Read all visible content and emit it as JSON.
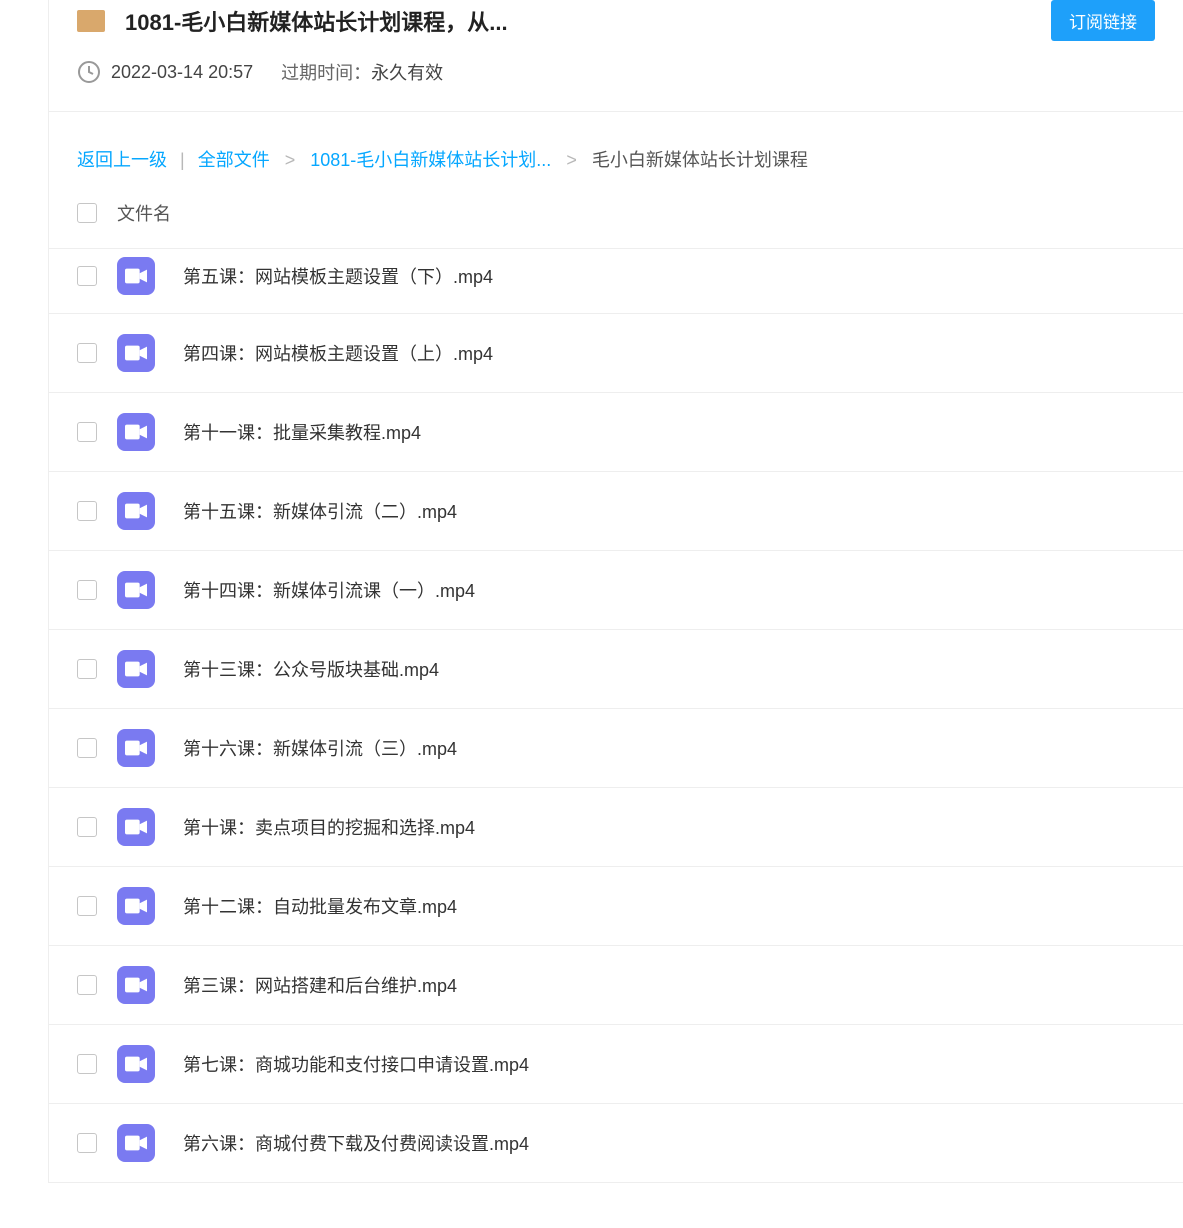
{
  "header": {
    "title": "1081-毛小白新媒体站长计划课程，从...",
    "subscribe_label": "订阅链接"
  },
  "meta": {
    "timestamp": "2022-03-14 20:57",
    "expiry_label": "过期时间：",
    "expiry_value": "永久有效"
  },
  "breadcrumb": {
    "back": "返回上一级",
    "all_files": "全部文件",
    "mid": "1081-毛小白新媒体站长计划...",
    "current": "毛小白新媒体站长计划课程"
  },
  "list": {
    "col_name": "文件名",
    "files": [
      "第五课：网站模板主题设置（下）.mp4",
      "第四课：网站模板主题设置（上）.mp4",
      "第十一课：批量采集教程.mp4",
      "第十五课：新媒体引流（二）.mp4",
      "第十四课：新媒体引流课（一）.mp4",
      "第十三课：公众号版块基础.mp4",
      "第十六课：新媒体引流（三）.mp4",
      "第十课：卖点项目的挖掘和选择.mp4",
      "第十二课：自动批量发布文章.mp4",
      "第三课：网站搭建和后台维护.mp4",
      "第七课：商城功能和支付接口申请设置.mp4",
      "第六课：商城付费下载及付费阅读设置.mp4"
    ]
  }
}
